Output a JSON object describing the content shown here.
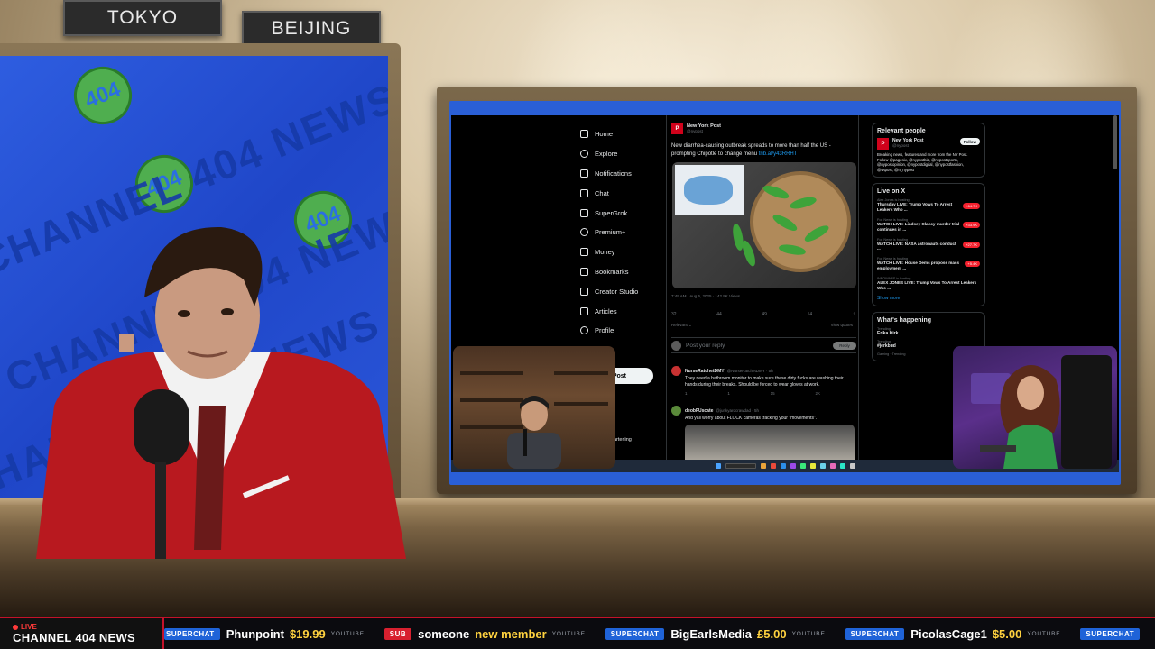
{
  "studio": {
    "city_signs": [
      "TOKYO",
      "BEIJING"
    ],
    "backdrop_text": "CHANNEL 404 NEWS",
    "backdrop_logo": "404"
  },
  "twitter": {
    "nav": [
      {
        "label": "Home",
        "icon": "home-icon"
      },
      {
        "label": "Explore",
        "icon": "search-icon"
      },
      {
        "label": "Notifications",
        "icon": "bell-icon"
      },
      {
        "label": "Chat",
        "icon": "chat-icon"
      },
      {
        "label": "SuperGrok",
        "icon": "grok-icon"
      },
      {
        "label": "Premium+",
        "icon": "x-premium-icon"
      },
      {
        "label": "Money",
        "icon": "money-icon"
      },
      {
        "label": "Bookmarks",
        "icon": "bookmark-icon"
      },
      {
        "label": "Creator Studio",
        "icon": "creator-studio-icon"
      },
      {
        "label": "Articles",
        "icon": "articles-icon"
      },
      {
        "label": "Profile",
        "icon": "profile-icon"
      }
    ],
    "post_button": "Post",
    "account_handle": "arterling",
    "tweet": {
      "author": "New York Post",
      "handle": "@nypost",
      "text": "New diarrhea-causing outbreak spreads to more than half the US - prompting Chipotle to change menu",
      "link": "trib.al/y43RRHT",
      "meta": "7:49 AM · Aug 6, 2025 · 142.9K Views",
      "actions": [
        "32",
        "44",
        "49",
        "14"
      ],
      "relevant_label": "Relevant ⌄",
      "view_quotes": "View quotes"
    },
    "reply_placeholder": "Post your reply",
    "reply_button": "Reply",
    "replies": [
      {
        "name": "NurseRatchetDMY",
        "handle": "@NurseRatchetDMY · 5h",
        "text": "They need a bathroom monitor to make sure these dirty fucks are washing their hands during their breaks. Should be forced to wear gloves at work.",
        "counts": [
          "1",
          "1",
          "15",
          "2K"
        ]
      },
      {
        "name": "deobFUscate",
        "handle": "@junkyardcrawdad · 5h",
        "text": "And yall worry about FLOCK cameras tracking your \"movements\".",
        "counts": []
      }
    ],
    "relevant_people": {
      "title": "Relevant people",
      "name": "New York Post",
      "handle": "@nypost",
      "follow": "Follow",
      "bio": "Breaking news, features and more from the NY Post. Follow @pagesix, @nypostbiz, @nypostsports, @nypostopinion, @nypostdigital, @nypostfashion, @wtpost, @n_nypost"
    },
    "live_on_x": {
      "title": "Live on X",
      "items": [
        {
          "host": "Alex Jones is hosting",
          "title": "Thursday LIVE: Trump Vows To Arrest Leakers Who ...",
          "count": "+64.7K"
        },
        {
          "host": "Fox News is hosting",
          "title": "WATCH LIVE: Lindsey Clancy murder trial continues in ...",
          "count": "+33.9K"
        },
        {
          "host": "Fox News is hosting",
          "title": "WATCH LIVE: NASA astronauts conduct ...",
          "count": "+27.7K"
        },
        {
          "host": "Fox News is hosting",
          "title": "WATCH LIVE: House Dems propose mass employment ...",
          "count": "+5.4K"
        },
        {
          "host": "INFOWARS is hosting",
          "title": "ALEX JONES LIVE: Trump Vows To Arrest Leakers Who ...",
          "count": ""
        }
      ],
      "show_more": "Show more"
    },
    "whats_happening": {
      "title": "What's happening",
      "items": [
        {
          "category": "Trending",
          "name": "Erika Kirk"
        },
        {
          "category": "Trending",
          "name": "#jerkbud"
        },
        {
          "category": "Gaming · Trending",
          "name": ""
        }
      ]
    }
  },
  "ticker": {
    "live_label": "LIVE",
    "channel": "CHANNEL 404 NEWS",
    "items": [
      {
        "tag": "SUPERCHAT",
        "tag_type": "superchat",
        "user": "",
        "amount": "",
        "source": ""
      },
      {
        "tag": "",
        "tag_type": "none",
        "user": "Phunpoint",
        "amount": "$19.99",
        "source": "YOUTUBE"
      },
      {
        "tag": "SUB",
        "tag_type": "sub",
        "user": "someone",
        "amount": "new member",
        "source": "YOUTUBE"
      },
      {
        "tag": "SUPERCHAT",
        "tag_type": "superchat",
        "user": "BigEarlsMedia",
        "amount": "£5.00",
        "source": "YOUTUBE"
      },
      {
        "tag": "SUPERCHAT",
        "tag_type": "superchat",
        "user": "PicolasCage1",
        "amount": "$5.00",
        "source": "YOUTUBE"
      },
      {
        "tag": "SUPERCHAT",
        "tag_type": "superchat",
        "user": "",
        "amount": "",
        "source": ""
      }
    ]
  },
  "colors": {
    "backdrop_blue": "#2e5de0",
    "ticker_red": "#c4122a",
    "superchat_blue": "#1f63d8",
    "amount_yellow": "#ffd23f",
    "x_link": "#1d9bf0"
  }
}
